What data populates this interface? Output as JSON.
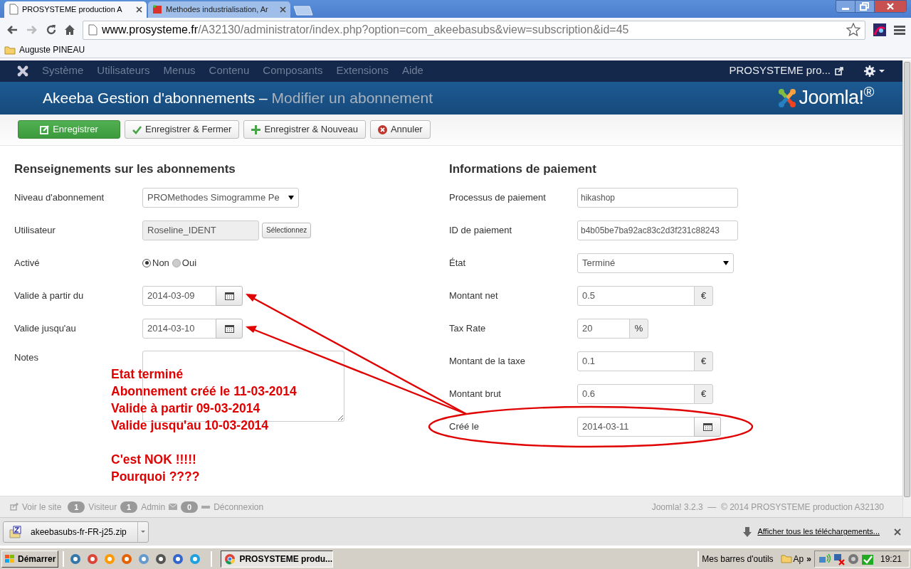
{
  "browser": {
    "tabs": [
      {
        "title": "PROSYSTEME production A",
        "selected": true
      },
      {
        "title": "Methodes industrialisation, Ar",
        "selected": false
      }
    ],
    "url": {
      "host": "www.prosysteme.fr",
      "path": "/A32130/administrator/index.php?option=com_akeebasubs&view=subscription&id=45"
    },
    "bookmarks": [
      "Auguste PINEAU"
    ]
  },
  "admin_nav": {
    "items": [
      "Système",
      "Utilisateurs",
      "Menus",
      "Contenu",
      "Composants",
      "Extensions",
      "Aide"
    ],
    "site_link": "PROSYSTEME pro..."
  },
  "header": {
    "title": "Akeeba Gestion d'abonnements –",
    "subtitle": "Modifier un abonnement",
    "logo": "Joomla!$^{®}$"
  },
  "toolbar": [
    {
      "label": "Enregistrer",
      "kind": "primary"
    },
    {
      "label": "Enregistrer & Fermer",
      "kind": "default"
    },
    {
      "label": "Enregistrer & Nouveau",
      "kind": "default"
    },
    {
      "label": "Annuler",
      "kind": "default"
    }
  ],
  "left_section": {
    "heading": "Renseignements sur les abonnements",
    "fields": [
      {
        "kind": "select",
        "label": "Niveau d'abonnement",
        "value": "PROMethodes Simogramme Pe"
      },
      {
        "kind": "user",
        "label": "Utilisateur",
        "value": "Roseline_IDENT",
        "button": "Sélectionnez"
      },
      {
        "kind": "radio",
        "label": "Activé",
        "options": [
          {
            "label": "Non",
            "selected": true
          },
          {
            "label": "Oui",
            "selected": false
          }
        ]
      },
      {
        "kind": "date",
        "label": "Valide à partir du",
        "value": "2014-03-09"
      },
      {
        "kind": "date",
        "label": "Valide jusqu'au",
        "value": "2014-03-10"
      },
      {
        "kind": "textarea",
        "label": "Notes"
      }
    ]
  },
  "right_section": {
    "heading": "Informations de paiement",
    "fields": [
      {
        "kind": "text",
        "label": "Processus de paiement",
        "value": "hikashop"
      },
      {
        "kind": "text",
        "label": "ID de paiement",
        "value": "b4b05be7ba92ac83c2d3f231c88243"
      },
      {
        "kind": "select",
        "label": "État",
        "value": "Terminé"
      },
      {
        "kind": "addon",
        "label": "Montant net",
        "value": "0.5",
        "suffix": "€"
      },
      {
        "kind": "addon_small",
        "label": "Tax Rate",
        "value": "20",
        "suffix": "%"
      },
      {
        "kind": "addon",
        "label": "Montant de la taxe",
        "value": "0.1",
        "suffix": "€"
      },
      {
        "kind": "addon",
        "label": "Montant brut",
        "value": "0.6",
        "suffix": "€"
      },
      {
        "kind": "date",
        "label": "Créé le",
        "value": "2014-03-11"
      }
    ]
  },
  "annotation": {
    "paragraphs": [
      [
        "Etat terminé",
        "Abonnement créé le 11-03-2014",
        "Valide à partir 09-03-2014",
        "Valide jusqu'au 10-03-2014"
      ],
      [
        "C'est NOK !!!!!",
        "Pourquoi ????"
      ]
    ]
  },
  "footer": {
    "view_site": "Voir le site",
    "visitors": "1",
    "visitors_label": "Visiteur",
    "admins": "1",
    "admins_label": "Admin",
    "messages": "0",
    "logout": "Déconnexion",
    "copyright": "Joomla! 3.2.3  —  © 2014 PROSYSTEME production A32130"
  },
  "downloads": {
    "file": "akeebasubs-fr-FR-j25.zip",
    "show_all": "Afficher tous les téléchargements..."
  },
  "taskbar": {
    "start": "Démarrer",
    "task": "PROSYSTEME produ...",
    "toolbars": "Mes barres d'outils",
    "folder": "Ap",
    "chevron": "»",
    "time": "19:21"
  }
}
